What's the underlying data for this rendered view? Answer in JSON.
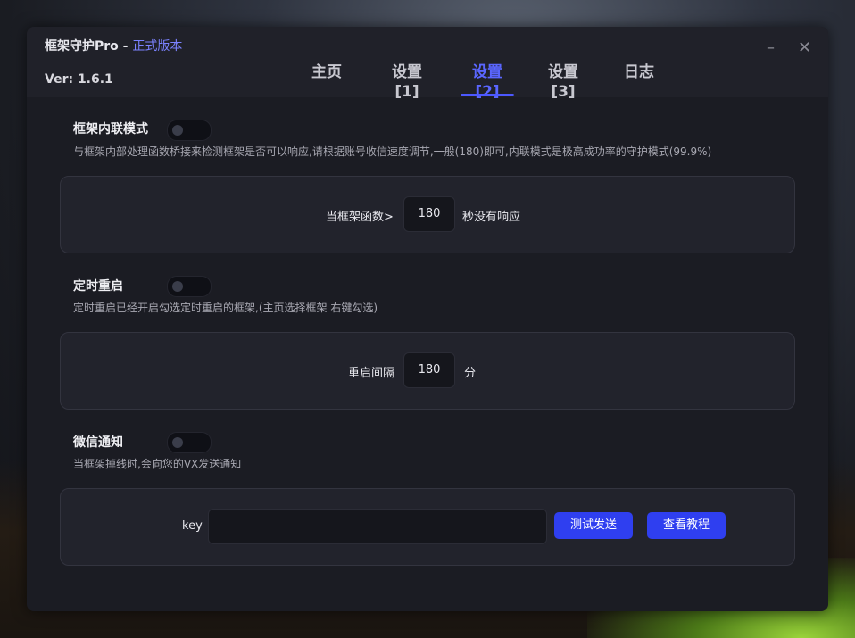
{
  "app": {
    "title": "框架守护Pro",
    "separator": " - ",
    "edition": "正式版本",
    "version": "Ver: 1.6.1"
  },
  "window_controls": {
    "minimize": "–",
    "close": "✕"
  },
  "tabs": [
    {
      "label": "主页",
      "active": false
    },
    {
      "label": "设置[1]",
      "active": false
    },
    {
      "label": "设置[2]",
      "active": true
    },
    {
      "label": "设置[3]",
      "active": false
    },
    {
      "label": "日志",
      "active": false
    }
  ],
  "sections": {
    "inline_mode": {
      "title": "框架内联模式",
      "enabled": false,
      "description": "与框架内部处理函数桥接来检测框架是否可以响应,请根据账号收信速度调节,一般(180)即可,内联模式是极高成功率的守护模式(99.9%)",
      "prefix": "当框架函数>",
      "value": "180",
      "suffix": "秒没有响应"
    },
    "timed_restart": {
      "title": "定时重启",
      "enabled": false,
      "description": "定时重启已经开启勾选定时重启的框架,(主页选择框架 右键勾选)",
      "prefix": "重启间隔",
      "value": "180",
      "suffix": "分"
    },
    "wechat_notify": {
      "title": "微信通知",
      "enabled": false,
      "description": "当框架掉线时,会向您的VX发送通知",
      "key_label": "key",
      "key_value": "",
      "test_button": "测试发送",
      "tutorial_button": "查看教程"
    }
  },
  "colors": {
    "accent": "#4c58ff",
    "button": "#2f3ff0",
    "window_bg": "#1b1c23",
    "card_bg": "#22232c"
  }
}
